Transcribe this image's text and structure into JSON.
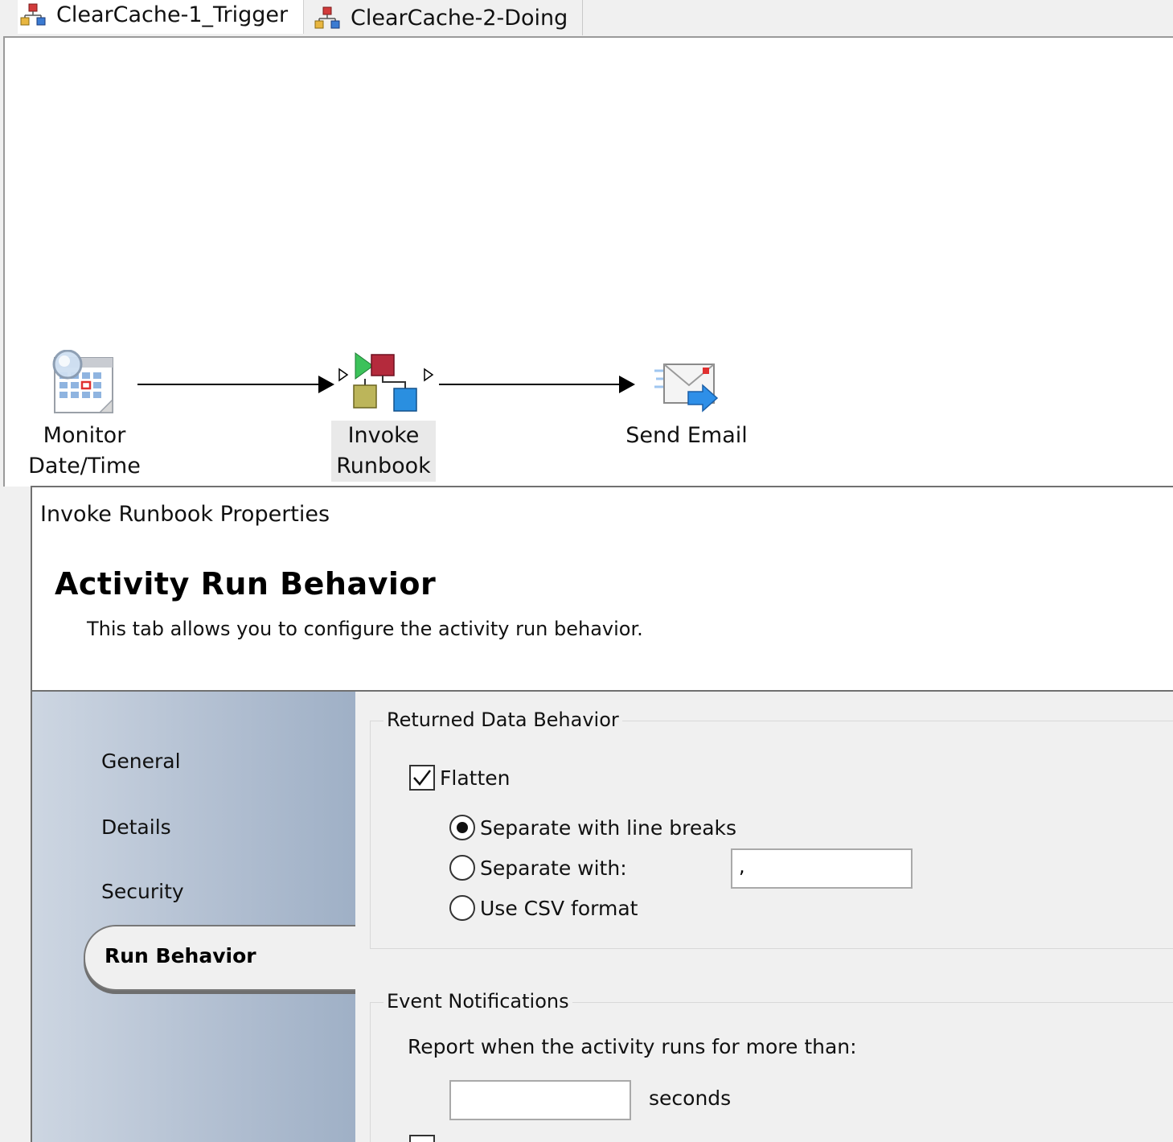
{
  "tabs": [
    {
      "label": "ClearCache-1_Trigger",
      "icon": "runbook-icon",
      "active": true
    },
    {
      "label": "ClearCache-2-Doing",
      "icon": "runbook-icon",
      "active": false
    }
  ],
  "workflow": {
    "nodes": [
      {
        "label_line1": "Monitor",
        "label_line2": "Date/Time",
        "icon": "calendar-clock-icon"
      },
      {
        "label_line1": "Invoke",
        "label_line2": "Runbook",
        "icon": "invoke-runbook-icon"
      },
      {
        "label_line1": "Send Email",
        "label_line2": "",
        "icon": "send-email-icon"
      }
    ]
  },
  "properties": {
    "header": "Invoke Runbook Properties",
    "section_title": "Activity Run Behavior",
    "section_description": "This tab allows you to configure the activity run behavior.",
    "nav": {
      "items": [
        "General",
        "Details",
        "Security"
      ],
      "active": "Run Behavior"
    },
    "returned_data": {
      "legend": "Returned Data Behavior",
      "flatten_label": "Flatten",
      "flatten_checked": true,
      "options": [
        {
          "label": "Separate with line breaks",
          "selected": true
        },
        {
          "label": "Separate with:",
          "selected": false
        },
        {
          "label": "Use CSV format",
          "selected": false
        }
      ],
      "separator_value": ","
    },
    "event_notifications": {
      "legend": "Event Notifications",
      "report_label": "Report when the activity runs for more than:",
      "seconds_value": "",
      "seconds_unit": "seconds"
    }
  },
  "colors": {
    "nav_gradient_start": "#cdd6e2",
    "nav_gradient_end": "#9fb0c6",
    "panel_bg": "#f0f0f0"
  }
}
